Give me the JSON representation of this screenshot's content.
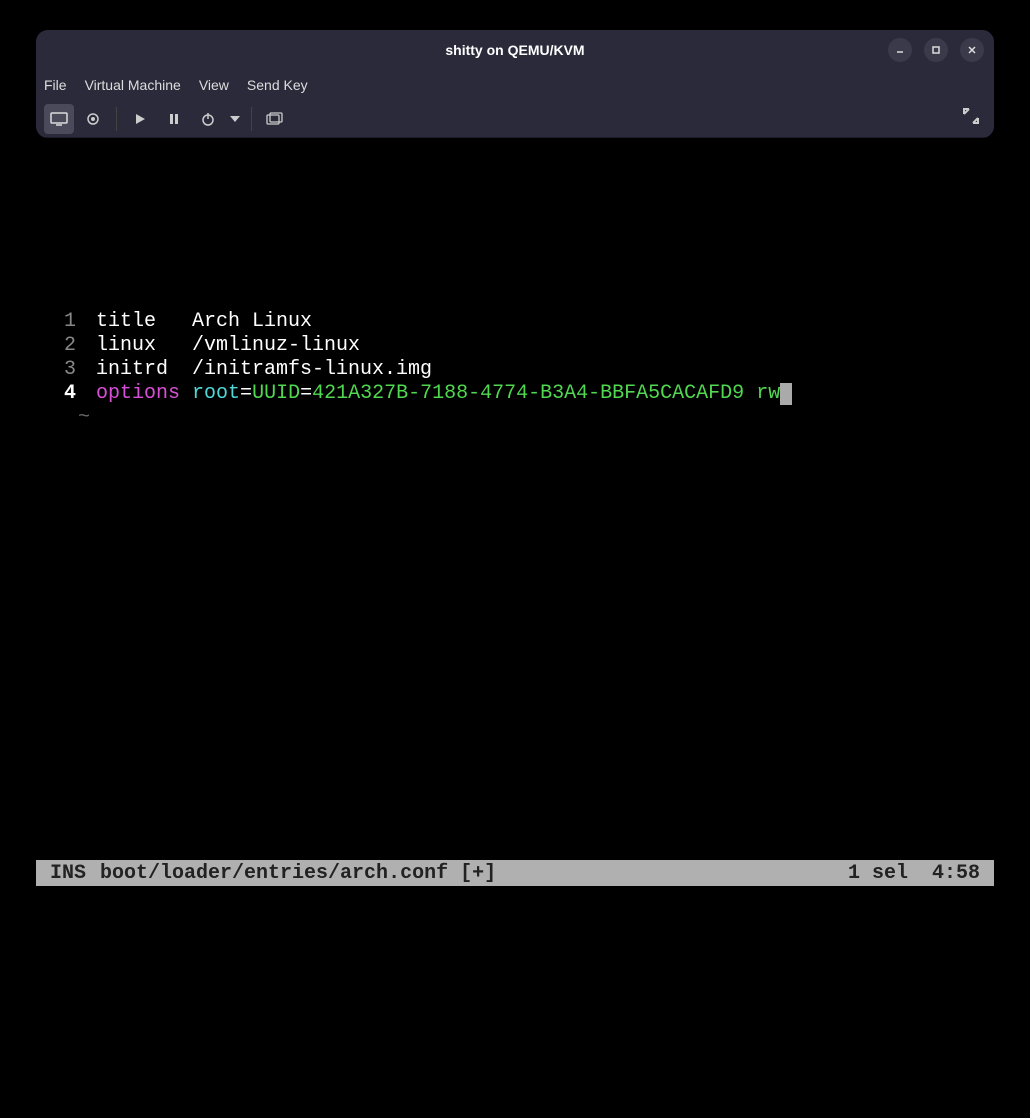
{
  "window": {
    "title": "shitty on QEMU/KVM"
  },
  "menu": {
    "file": "File",
    "vm": "Virtual Machine",
    "view": "View",
    "sendkey": "Send Key"
  },
  "editor": {
    "lines": [
      {
        "num": "1",
        "segments": [
          {
            "cls": "kw-white",
            "text": "title   Arch Linux"
          }
        ]
      },
      {
        "num": "2",
        "segments": [
          {
            "cls": "kw-white",
            "text": "linux   /vmlinuz-linux"
          }
        ]
      },
      {
        "num": "3",
        "segments": [
          {
            "cls": "kw-white",
            "text": "initrd  /initramfs-linux.img"
          }
        ]
      },
      {
        "num": "4",
        "segments": [
          {
            "cls": "kw-magenta",
            "text": "options"
          },
          {
            "cls": "kw-white",
            "text": " "
          },
          {
            "cls": "kw-cyan",
            "text": "root"
          },
          {
            "cls": "kw-white",
            "text": "="
          },
          {
            "cls": "kw-green",
            "text": "UUID"
          },
          {
            "cls": "kw-white",
            "text": "="
          },
          {
            "cls": "kw-green",
            "text": "421A327B-7188-4774-B3A4-BBFA5CACAFD9"
          },
          {
            "cls": "kw-white",
            "text": " "
          },
          {
            "cls": "kw-green",
            "text": "rw"
          }
        ],
        "cursor": true
      }
    ],
    "tilde": "~"
  },
  "statusbar": {
    "mode": "INS",
    "file": "boot/loader/entries/arch.conf [+]",
    "sel": "1 sel",
    "pos": "4:58"
  }
}
